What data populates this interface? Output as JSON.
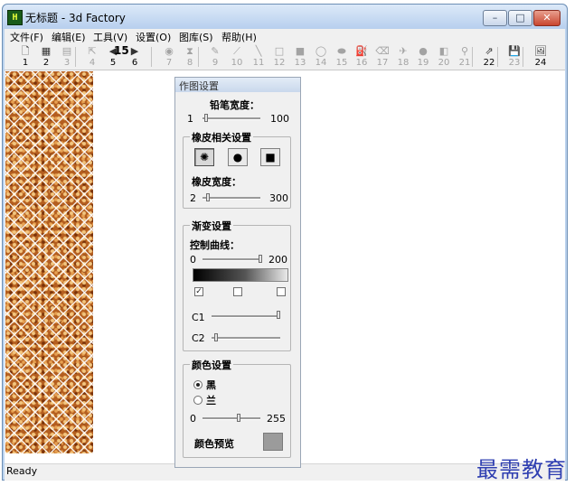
{
  "window": {
    "title": "无标题 - 3d Factory",
    "app_icon_text": "H"
  },
  "caption_buttons": {
    "minimize": "–",
    "maximize": "□",
    "close": "✕"
  },
  "menu": [
    "文件(F)",
    "编辑(E)",
    "工具(V)",
    "设置(O)",
    "图库(S)",
    "帮助(H)"
  ],
  "toolbar": {
    "tools": [
      {
        "icon": "new-file-icon",
        "glyph": "🗋",
        "num": "1",
        "enabled": true
      },
      {
        "icon": "grid-icon",
        "glyph": "▦",
        "num": "2",
        "enabled": true
      },
      {
        "icon": "layers-icon",
        "glyph": "▤",
        "num": "3",
        "enabled": false
      },
      {
        "icon": "pointer-icon",
        "glyph": "⇱",
        "num": "4",
        "enabled": false
      },
      {
        "icon": "left-arrow-icon",
        "glyph": "◀",
        "num": "5",
        "enabled": true
      },
      {
        "icon": "right-arrow-icon",
        "glyph": "▶",
        "num": "6",
        "enabled": true
      },
      {
        "icon": "eye-icon",
        "glyph": "◉",
        "num": "7",
        "enabled": false
      },
      {
        "icon": "funnel-icon",
        "glyph": "⧗",
        "num": "8",
        "enabled": false
      },
      {
        "icon": "pencil-icon",
        "glyph": "✎",
        "num": "9",
        "enabled": false
      },
      {
        "icon": "brush-icon",
        "glyph": "⟋",
        "num": "10",
        "enabled": false
      },
      {
        "icon": "line-icon",
        "glyph": "╲",
        "num": "11",
        "enabled": false
      },
      {
        "icon": "rectangle-outline-icon",
        "glyph": "□",
        "num": "12",
        "enabled": false
      },
      {
        "icon": "rectangle-filled-icon",
        "glyph": "■",
        "num": "13",
        "enabled": false
      },
      {
        "icon": "ellipse-outline-icon",
        "glyph": "◯",
        "num": "14",
        "enabled": false
      },
      {
        "icon": "ellipse-filled-icon",
        "glyph": "⬬",
        "num": "15",
        "enabled": false
      },
      {
        "icon": "paint-bucket-icon",
        "glyph": "⛽",
        "num": "16",
        "enabled": false
      },
      {
        "icon": "eraser-icon",
        "glyph": "⌫",
        "num": "17",
        "enabled": false
      },
      {
        "icon": "spray-icon",
        "glyph": "✈",
        "num": "18",
        "enabled": false
      },
      {
        "icon": "circle-filled-icon",
        "glyph": "●",
        "num": "19",
        "enabled": false
      },
      {
        "icon": "half-fill-icon",
        "glyph": "◧",
        "num": "20",
        "enabled": false
      },
      {
        "icon": "eyedropper-icon",
        "glyph": "⚲",
        "num": "21",
        "enabled": false
      },
      {
        "icon": "export-icon",
        "glyph": "⇗",
        "num": "22",
        "enabled": true
      },
      {
        "icon": "save-icon",
        "glyph": "💾",
        "num": "23",
        "enabled": false
      },
      {
        "icon": "image-library-icon",
        "glyph": "🖼",
        "num": "24",
        "enabled": true
      }
    ],
    "page_value": "15"
  },
  "status": "Ready",
  "panel": {
    "title": "作图设置",
    "pencil_width": {
      "label": "铅笔宽度：",
      "min": "1",
      "max": "100"
    },
    "eraser_group": {
      "legend": "橡皮相关设置",
      "width_label": "橡皮宽度：",
      "min": "2",
      "max": "300"
    },
    "eraser_shapes": [
      {
        "icon": "sunburst-icon",
        "glyph": "✺",
        "active": true
      },
      {
        "icon": "round-brush-icon",
        "glyph": "●",
        "active": false
      },
      {
        "icon": "square-brush-icon",
        "glyph": "■",
        "active": false
      }
    ],
    "gradient_group": {
      "legend": "渐变设置",
      "curve_label": "控制曲线：",
      "min": "0",
      "max": "200",
      "checks": [
        true,
        false,
        false
      ],
      "c1": "C1",
      "c2": "C2"
    },
    "color_group": {
      "legend": "颜色设置",
      "option_black": "黑",
      "option_blue": "兰",
      "selected": "black",
      "min": "0",
      "max": "255",
      "preview_label": "颜色预览",
      "preview_color": "#9b9b9b"
    }
  },
  "watermark": "最需教育"
}
